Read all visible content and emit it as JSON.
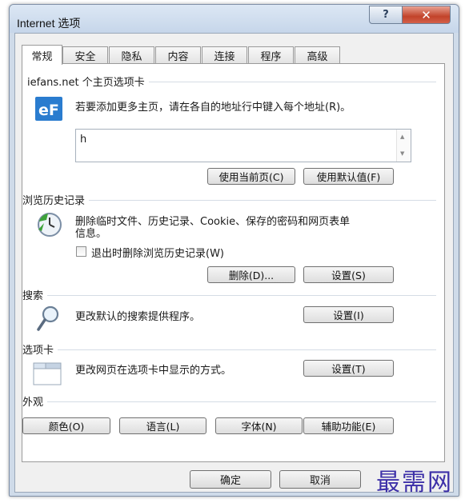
{
  "window": {
    "title": "Internet 选项",
    "help_label": "?",
    "close_label": "✕"
  },
  "tabs": [
    "常规",
    "安全",
    "隐私",
    "内容",
    "连接",
    "程序",
    "高级"
  ],
  "home": {
    "group_title": "iefans.net 个主页选项卡",
    "instruction": "若要添加更多主页，请在各自的地址行中键入每个地址(R)。",
    "value": "h",
    "use_current_label": "使用当前页(C)",
    "use_default_label": "使用默认值(F)",
    "icon": "ie-logo-icon"
  },
  "history": {
    "group_title": "浏览历史记录",
    "description_line1": "删除临时文件、历史记录、Cookie、保存的密码和网页表单",
    "description_line2": "信息。",
    "checkbox_label": "退出时删除浏览历史记录(W)",
    "checkbox_checked": false,
    "delete_label": "删除(D)...",
    "settings_label": "设置(S)",
    "icon": "history-clock-icon"
  },
  "search": {
    "group_title": "搜索",
    "description": "更改默认的搜索提供程序。",
    "settings_label": "设置(I)",
    "icon": "magnifier-icon"
  },
  "tabs_section": {
    "group_title": "选项卡",
    "description": "更改网页在选项卡中显示的方式。",
    "settings_label": "设置(T)",
    "icon": "tabs-window-icon"
  },
  "appearance": {
    "group_title": "外观",
    "colors_label": "颜色(O)",
    "languages_label": "语言(L)",
    "fonts_label": "字体(N)",
    "accessibility_label": "辅助功能(E)"
  },
  "footer": {
    "ok_label": "确定",
    "cancel_label": "取消"
  },
  "watermark": "最需网",
  "colors": {
    "titlebar": "#c6d6ea",
    "close": "#c2432a",
    "watermark": "#3d30a8"
  }
}
